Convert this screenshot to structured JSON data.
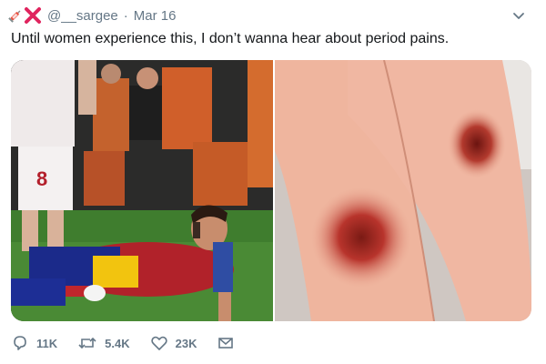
{
  "tweet": {
    "handle": "@__sargee",
    "separator": "·",
    "date": "Mar 16",
    "text": "Until women experience this, I don’t wanna hear about period pains.",
    "header_icons": [
      "syringe-icon",
      "red-x-icon"
    ],
    "menu_icon": "chevron-down-icon"
  },
  "actions": {
    "reply": {
      "icon": "reply-icon",
      "count": "11K"
    },
    "retweet": {
      "icon": "retweet-icon",
      "count": "5.4K"
    },
    "like": {
      "icon": "heart-icon",
      "count": "23K"
    },
    "message": {
      "icon": "envelope-icon"
    }
  },
  "media": {
    "photo_left_jersey_number": "8"
  },
  "colors": {
    "text": "#14171a",
    "muted": "#657786",
    "accent_red": "#e0245e"
  }
}
